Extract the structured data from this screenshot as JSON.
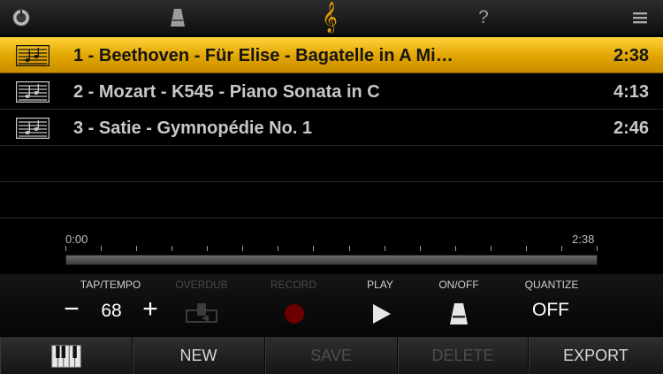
{
  "topbar": {
    "icons": [
      "knob-icon",
      "metronome-icon",
      "treble-clef-icon",
      "help-icon",
      "menu-icon"
    ],
    "help_text": "?",
    "clef_glyph": "𝄞",
    "accent_color": "#e0a200"
  },
  "songs": [
    {
      "title": "1 - Beethoven - Für Elise - Bagatelle in A Mi…",
      "duration": "2:38",
      "selected": true
    },
    {
      "title": "2 - Mozart - K545 - Piano Sonata in C",
      "duration": "4:13",
      "selected": false
    },
    {
      "title": "3 - Satie - Gymnopédie No. 1",
      "duration": "2:46",
      "selected": false
    }
  ],
  "timeline": {
    "start_label": "0:00",
    "end_label": "2:38",
    "tick_count": 16
  },
  "controls": {
    "tap_tempo_label": "TAP/TEMPO",
    "overdub_label": "OVERDUB",
    "record_label": "RECORD",
    "play_label": "PLAY",
    "onoff_label": "ON/OFF",
    "quantize_label": "QUANTIZE",
    "minus": "−",
    "plus": "+",
    "tempo_value": "68",
    "quantize_value": "OFF"
  },
  "bottombar": {
    "new_label": "NEW",
    "save_label": "SAVE",
    "delete_label": "DELETE",
    "export_label": "EXPORT"
  },
  "colors": {
    "selected_row": "#e1a500",
    "record_dot": "#6a0000",
    "disabled_text": "#4d4d4d"
  }
}
